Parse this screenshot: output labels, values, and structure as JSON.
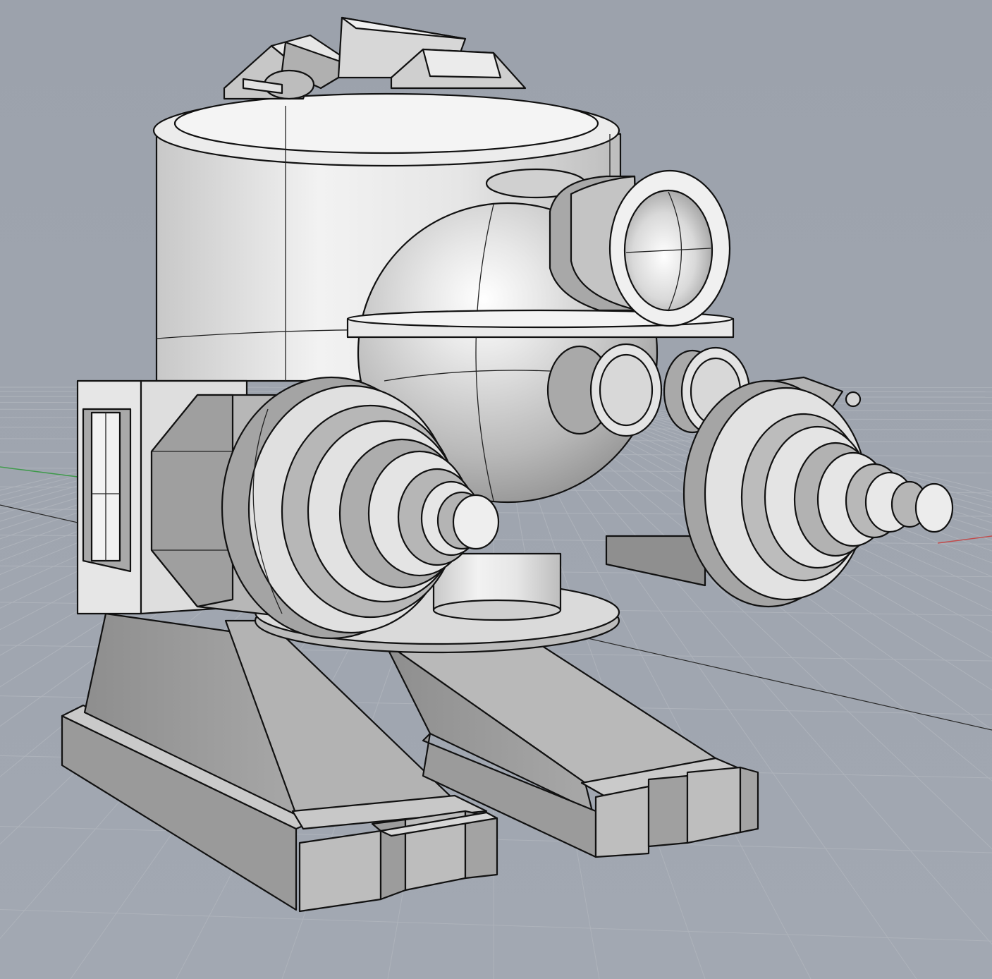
{
  "viewport": {
    "view": "perspective",
    "display_mode": "shaded",
    "background_color": "#9ea4ae",
    "grid": true,
    "x_axis_color": "#c24a4a",
    "y_axis_color": "#3e9a4a"
  },
  "model": {
    "subject": "mech-robot",
    "surface_color": "#d6d6d6",
    "edge_color": "#111111"
  }
}
